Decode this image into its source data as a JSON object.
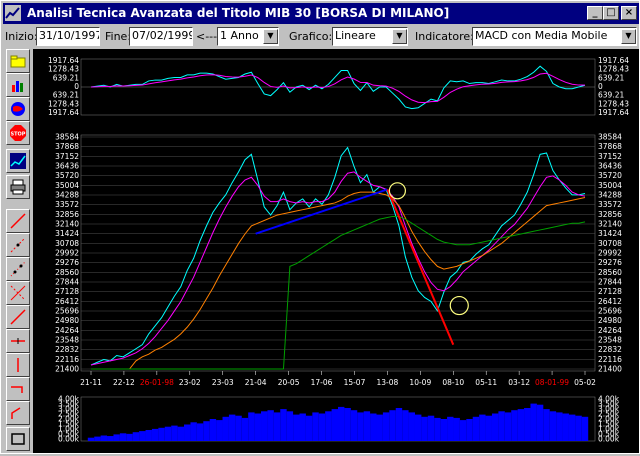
{
  "window": {
    "title": "Analisi Tecnica Avanzata del Titolo  MIB 30  [BORSA DI MILANO]",
    "controls": [
      "_",
      "□",
      "×"
    ]
  },
  "toolbar": {
    "start_label": "Inizio:",
    "start_value": "31/10/1997",
    "end_label": "Fine:",
    "end_value": "07/02/1999",
    "arrow_label": "<---",
    "period_value": "1 Anno",
    "chart_label": "Grafico:",
    "chart_value": "Lineare",
    "indicator_label": "Indicatore:",
    "indicator_value": "MACD con Media Mobile"
  },
  "left_tools": [
    "open-folder-icon",
    "bar-chart-icon",
    "globe-icon",
    "stop-icon",
    "zoom-chart-icon",
    "print-icon",
    "trendline-red-icon",
    "dotted-line-icon",
    "dotted-line-2-icon",
    "fan-line-icon",
    "line-tool-icon",
    "horizontal-line-icon",
    "vertical-line-icon",
    "hook-line-icon",
    "step-line-icon",
    "rectangle-icon"
  ],
  "colors": {
    "price": "#00ffff",
    "ma_short": "#ff00ff",
    "ma_mid": "#ff8000",
    "ma_long": "#00a000",
    "trend_blue": "#0000ff",
    "trend_red": "#ff0000",
    "volume": "#0000ff",
    "circle": "#ffff80"
  },
  "macd_axis_labels": [
    "1917.64",
    "1278.43",
    "639.21",
    "0",
    "639.21",
    "1278.43",
    "1917.64"
  ],
  "chart_data": {
    "type": "line",
    "title": "",
    "xlabel": "",
    "ylabel": "",
    "ylim": [
      21400,
      38584
    ],
    "y_ticks": [
      38584,
      37868,
      37152,
      36436,
      35720,
      35004,
      34288,
      33572,
      32856,
      32140,
      31424,
      30708,
      29992,
      29276,
      28560,
      27844,
      27128,
      26412,
      25696,
      24980,
      24264,
      23548,
      22832,
      22116,
      21400
    ],
    "x_ticks": [
      "21-11",
      "22-12",
      "26-01-98",
      "23-02",
      "23-03",
      "21-04",
      "20-05",
      "17-06",
      "15-07",
      "13-08",
      "10-09",
      "08-10",
      "05-11",
      "03-12",
      "08-01-99",
      "05-02"
    ],
    "x_tick_colors": [
      "#ffffff",
      "#ffffff",
      "#ff0000",
      "#ffffff",
      "#ffffff",
      "#ffffff",
      "#ffffff",
      "#ffffff",
      "#ffffff",
      "#ffffff",
      "#ffffff",
      "#ffffff",
      "#ffffff",
      "#ffffff",
      "#ff0000",
      "#ffffff"
    ],
    "series": [
      {
        "values": [
          21700,
          21900,
          22100,
          22000,
          22400,
          22300,
          22600,
          22900,
          23200,
          24000,
          24600,
          25200,
          26000,
          26800,
          27500,
          28700,
          29600,
          30900,
          32000,
          33000,
          33700,
          34300,
          35200,
          36000,
          36900,
          37300,
          35400,
          33400,
          32800,
          33500,
          34500,
          33200,
          33700,
          34000,
          33400,
          34000,
          33600,
          34300,
          35600,
          37200,
          37800,
          36400,
          35200,
          35800,
          34500,
          34900,
          34700,
          33500,
          32000,
          29700,
          28200,
          27200,
          26700,
          26400,
          25700,
          27100,
          28200,
          28600,
          29300,
          29400,
          29900,
          30300,
          30600,
          31300,
          32000,
          32400,
          32800,
          33600,
          34500,
          35800,
          37300,
          37400,
          36100,
          35400,
          34800,
          34300,
          34300,
          34400
        ]
      },
      {
        "values": [
          21700,
          21800,
          21900,
          22000,
          22100,
          22200,
          22400,
          22600,
          22900,
          23300,
          23800,
          24400,
          25000,
          25700,
          26400,
          27300,
          28200,
          29300,
          30400,
          31500,
          32500,
          33400,
          34200,
          34900,
          35400,
          35600,
          35000,
          34200,
          33800,
          33800,
          34000,
          33800,
          33700,
          33800,
          33700,
          33800,
          33800,
          34000,
          34500,
          35300,
          35900,
          36000,
          35600,
          35300,
          35000,
          34900,
          34700,
          34200,
          33400,
          32000,
          30700,
          29600,
          28600,
          27800,
          27300,
          27200,
          27500,
          28000,
          28600,
          29000,
          29400,
          29800,
          30200,
          30700,
          31200,
          31700,
          32100,
          32700,
          33300,
          34100,
          34900,
          35600,
          35700,
          35400,
          35000,
          34500,
          34300,
          34200
        ]
      },
      {
        "values": [
          21400,
          21400,
          21400,
          21400,
          21400,
          21400,
          21400,
          22000,
          22300,
          22500,
          22800,
          23000,
          23300,
          23600,
          24000,
          24500,
          25100,
          25800,
          26600,
          27400,
          28300,
          29100,
          29900,
          30700,
          31400,
          32000,
          32200,
          32400,
          32600,
          32800,
          32900,
          33000,
          33100,
          33200,
          33300,
          33400,
          33500,
          33600,
          33700,
          33900,
          34200,
          34400,
          34500,
          34500,
          34500,
          34400,
          34300,
          34000,
          33500,
          32600,
          31600,
          30800,
          30100,
          29500,
          29000,
          28800,
          28900,
          29000,
          29200,
          29400,
          29600,
          29800,
          30100,
          30400,
          30700,
          31100,
          31500,
          31900,
          32300,
          32700,
          33100,
          33500,
          33600,
          33700,
          33800,
          33900,
          34000,
          34100
        ]
      },
      {
        "values": [
          21400,
          21400,
          21400,
          21400,
          21400,
          21400,
          21400,
          21400,
          21400,
          21400,
          21400,
          21400,
          21400,
          21400,
          21400,
          21400,
          21400,
          21400,
          21400,
          21400,
          21400,
          21400,
          21400,
          21400,
          21400,
          21400,
          21400,
          21400,
          21400,
          21400,
          21400,
          29000,
          29200,
          29500,
          29800,
          30100,
          30400,
          30700,
          31000,
          31300,
          31500,
          31700,
          31900,
          32100,
          32300,
          32500,
          32600,
          32700,
          32700,
          32500,
          32200,
          31900,
          31600,
          31300,
          31000,
          30800,
          30700,
          30600,
          30600,
          30600,
          30700,
          30800,
          30900,
          31000,
          31100,
          31200,
          31300,
          31400,
          31500,
          31600,
          31700,
          31800,
          31900,
          32000,
          32100,
          32200,
          32200,
          32300
        ]
      }
    ],
    "trendlines": [
      {
        "color": "blue",
        "from": [
          "21-04",
          31424
        ],
        "to": [
          "13-08",
          34700
        ]
      },
      {
        "color": "red",
        "from": [
          "13-08",
          34700
        ],
        "to": [
          "08-10",
          23200
        ]
      }
    ],
    "volume_axis_labels": [
      "4.00k",
      "3.50k",
      "3.00k",
      "2.50k",
      "2.00k",
      "1.50k",
      "1.00k",
      "0.50k",
      "0.00k"
    ],
    "volume_ylim": [
      0,
      4000
    ],
    "volume": [
      300,
      400,
      500,
      450,
      600,
      700,
      650,
      800,
      900,
      1000,
      1100,
      1200,
      1300,
      1400,
      1300,
      1500,
      1700,
      1600,
      1800,
      2000,
      1900,
      2200,
      2400,
      2300,
      2100,
      2600,
      2500,
      2700,
      2800,
      2600,
      2900,
      2700,
      2400,
      2500,
      2300,
      2600,
      2500,
      2700,
      2900,
      3100,
      3000,
      2800,
      2600,
      2700,
      2500,
      2400,
      2600,
      2800,
      3000,
      2800,
      2600,
      2400,
      2200,
      2300,
      2100,
      2000,
      2200,
      2100,
      1900,
      2000,
      2200,
      2400,
      2300,
      2500,
      2700,
      2600,
      2800,
      2900,
      3000,
      3400,
      3300,
      2900,
      2700,
      2600,
      2500,
      2400,
      2300,
      2200
    ]
  }
}
